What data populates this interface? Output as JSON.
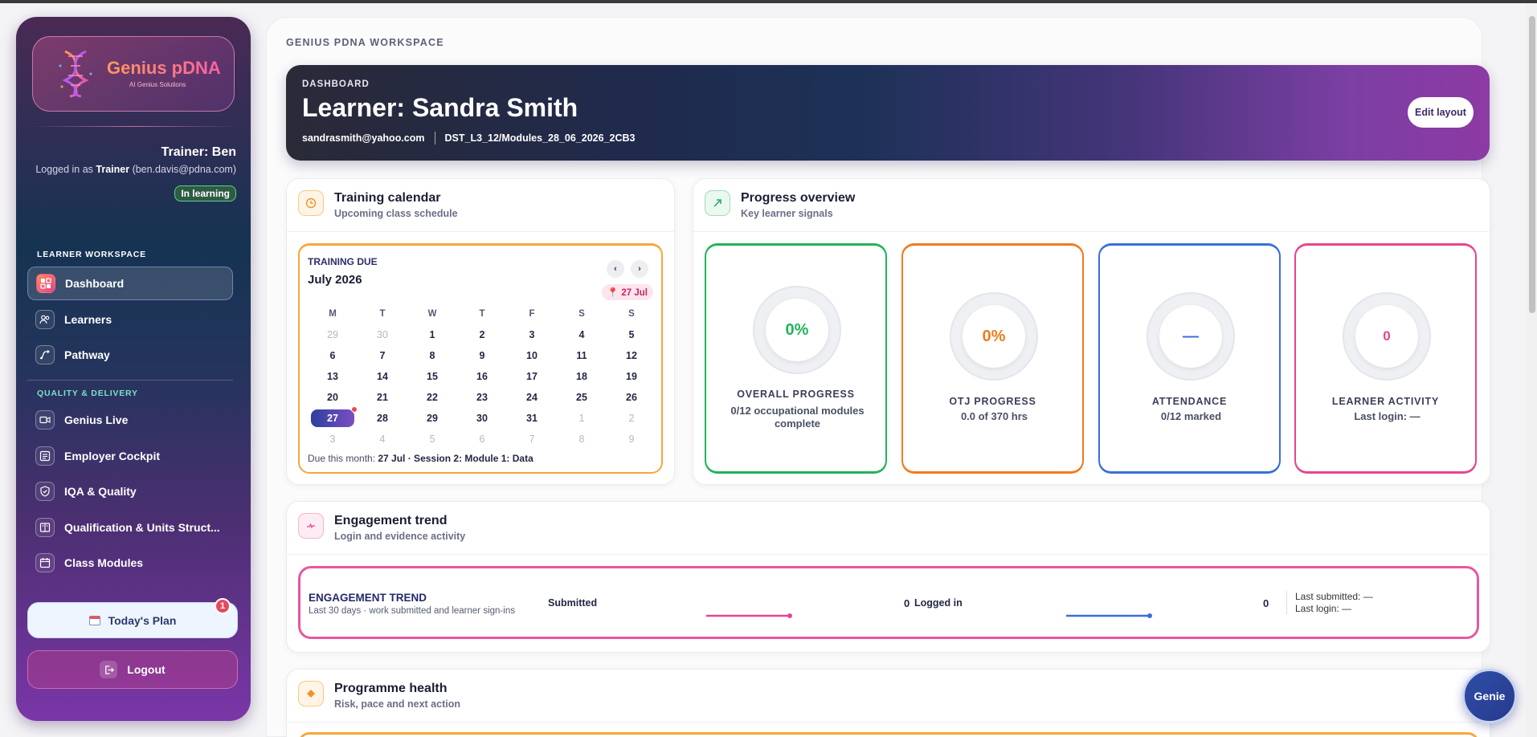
{
  "sidebar": {
    "logo": {
      "title": "Genius pDNA",
      "subtitle": "AI Genius Solutions"
    },
    "trainer_name": "Trainer: Ben",
    "logged_in_prefix": "Logged in as ",
    "logged_in_role": "Trainer",
    "logged_in_email": " (ben.davis@pdna.com)",
    "status_badge": "In learning",
    "sections": [
      {
        "label": "LEARNER WORKSPACE",
        "color": "#ffffff"
      },
      {
        "label": "QUALITY & DELIVERY",
        "color": "#7ee0c5"
      }
    ],
    "items": [
      {
        "label": "Dashboard"
      },
      {
        "label": "Learners"
      },
      {
        "label": "Pathway"
      },
      {
        "label": "Genius Live"
      },
      {
        "label": "Employer Cockpit"
      },
      {
        "label": "IQA & Quality"
      },
      {
        "label": "Qualification & Units Struct..."
      },
      {
        "label": "Class Modules"
      }
    ],
    "today_plan": "Today's Plan",
    "today_plan_badge": "1",
    "logout": "Logout"
  },
  "main": {
    "workspace_label": "GENIUS PDNA WORKSPACE",
    "hero": {
      "kicker": "DASHBOARD",
      "title": "Learner: Sandra Smith",
      "email": "sandrasmith@yahoo.com",
      "cohort": "DST_L3_12/Modules_28_06_2026_2CB3",
      "edit_button": "Edit layout"
    },
    "calendar": {
      "title": "Training calendar",
      "subtitle": "Upcoming class schedule",
      "kicker": "TRAINING DUE",
      "month": "July 2026",
      "pin": "27 Jul",
      "prev": "‹",
      "next": "›",
      "dow": [
        "M",
        "T",
        "W",
        "T",
        "F",
        "S",
        "S"
      ],
      "weeks": [
        [
          "29",
          "30",
          "1",
          "2",
          "3",
          "4",
          "5"
        ],
        [
          "6",
          "7",
          "8",
          "9",
          "10",
          "11",
          "12"
        ],
        [
          "13",
          "14",
          "15",
          "16",
          "17",
          "18",
          "19"
        ],
        [
          "20",
          "21",
          "22",
          "23",
          "24",
          "25",
          "26"
        ],
        [
          "27",
          "28",
          "29",
          "30",
          "31",
          "1",
          "2"
        ],
        [
          "3",
          "4",
          "5",
          "6",
          "7",
          "8",
          "9"
        ]
      ],
      "footer_prefix": "Due this month: ",
      "footer_value": "27 Jul · Session 2: Module 1: Data"
    },
    "progress": {
      "title": "Progress overview",
      "subtitle": "Key learner signals",
      "metrics": [
        {
          "value": "0%",
          "label": "OVERALL PROGRESS",
          "detail": "0/12 occupational modules complete",
          "color": "#22b35a"
        },
        {
          "value": "0%",
          "label": "OTJ PROGRESS",
          "detail": "0.0 of 370 hrs",
          "color": "#f07b1e"
        },
        {
          "value": "—",
          "label": "ATTENDANCE",
          "detail": "0/12 marked",
          "color": "#3a6fd8"
        },
        {
          "value": "0",
          "label": "LEARNER ACTIVITY",
          "detail": "Last login: —",
          "color": "#e6458f"
        }
      ]
    },
    "engagement": {
      "title": "Engagement trend",
      "subtitle": "Login and evidence activity",
      "kicker": "ENGAGEMENT TREND",
      "kicker_sub": "Last 30 days · work submitted and learner sign-ins",
      "submitted_label": "Submitted",
      "submitted_value": "0",
      "logged_label": "Logged in",
      "logged_value": "0",
      "last_submitted": "Last submitted: —",
      "last_login": "Last login: —"
    },
    "health": {
      "title": "Programme health",
      "subtitle": "Risk, pace and next action"
    }
  },
  "genie": "Genie"
}
